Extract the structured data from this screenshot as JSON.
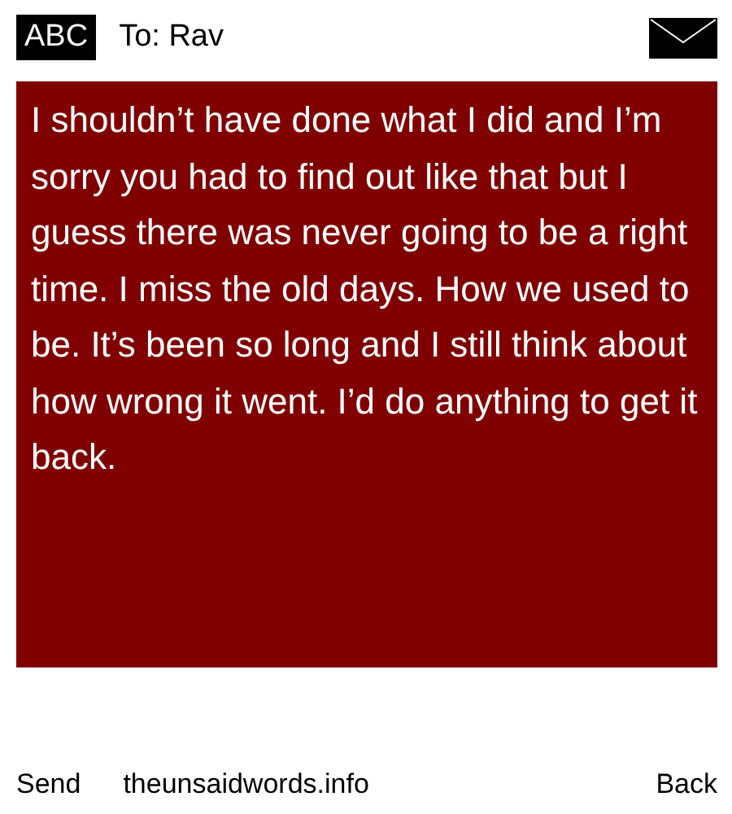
{
  "header": {
    "mode_label": "ABC",
    "recipient": "To: Rav"
  },
  "message": {
    "body": "I shouldn’t have done what I did and I’m sorry you had to find out like that but I guess there was never going to be a right time. I miss the old days. How we used to be. It’s been so long and I still think about how wrong it went. I’d do anything to get it back."
  },
  "footer": {
    "left": "Send",
    "center": "theunsaidwords.info",
    "right": "Back"
  }
}
